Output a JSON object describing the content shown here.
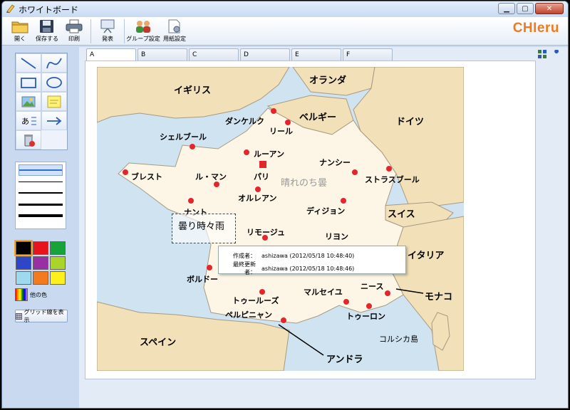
{
  "window": {
    "title": "ホワイトボード"
  },
  "toolbar": {
    "open": "開く",
    "save": "保存する",
    "print": "印刷",
    "present": "発表",
    "group_settings": "グループ設定",
    "paper_settings": "用紙設定"
  },
  "brand": "CHIeru",
  "tabs": [
    "A",
    "B",
    "C",
    "D",
    "E",
    "F"
  ],
  "active_tab": "A",
  "left_panel": {
    "tools": [
      "line-icon",
      "freehand-icon",
      "rectangle-icon",
      "ellipse-icon",
      "image-icon",
      "sticky-note-icon",
      "text-icon",
      "arrow-icon",
      "delete-icon"
    ],
    "colors": [
      "#000000",
      "#e8141c",
      "#16a33a",
      "#2e46c8",
      "#9a2fa3",
      "#a9d52a",
      "#9ed9ee",
      "#f47a1e",
      "#ffef1a"
    ],
    "more_colors": "他の色",
    "grid_button": "グリッド線を表示"
  },
  "map": {
    "countries": [
      "イギリス",
      "オランダ",
      "ベルギー",
      "ドイツ",
      "スイス",
      "イタリア",
      "モナコ",
      "スペイン",
      "アンドラ",
      "コルシカ島"
    ],
    "cities": [
      "ダンケルク",
      "リール",
      "シェルブール",
      "ルーアン",
      "ナンシー",
      "ブレスト",
      "ル・マン",
      "パリ",
      "ストラスブール",
      "オルレアン",
      "ナント",
      "ディジョン",
      "リモージュ",
      "リヨン",
      "ボルドー",
      "ニース",
      "トゥールーズ",
      "マルセイユ",
      "ペルピニャン",
      "トゥーロン"
    ],
    "weather_label": "晴れのち曇",
    "note_text": "曇り時々雨"
  },
  "tooltip": {
    "author_label": "作成者：",
    "author_value": "ashizawa (2012/05/18 10:48:40)",
    "updater_label": "最終更新者：",
    "updater_value": "ashizawa (2012/05/18 10:48:46)"
  }
}
